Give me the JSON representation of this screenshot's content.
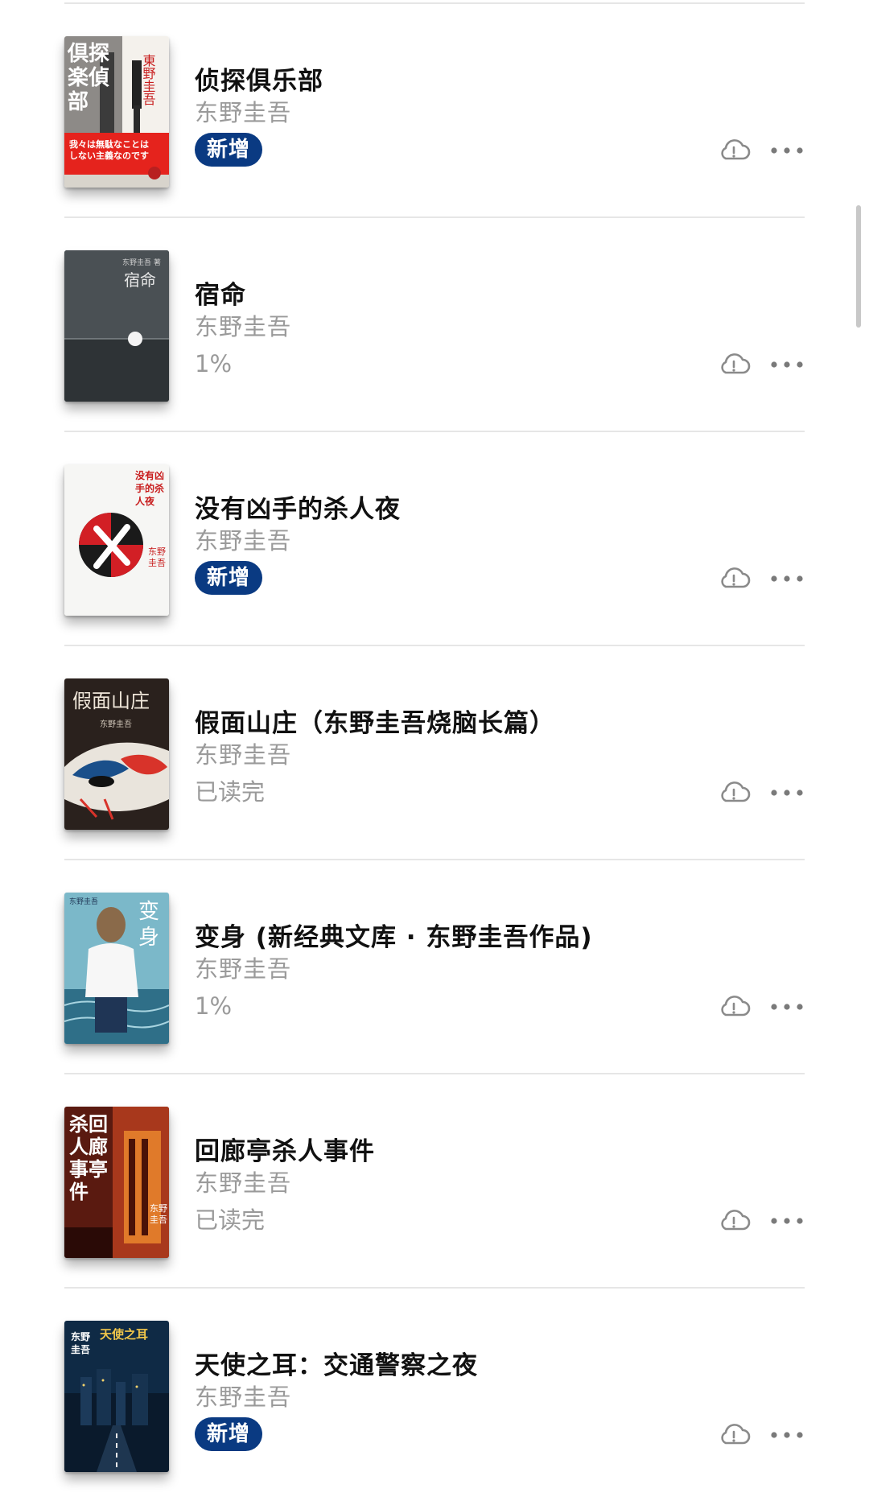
{
  "books": [
    {
      "title": "侦探俱乐部",
      "author": "东野圭吾",
      "status_type": "badge",
      "status": "新增",
      "cover_text": "探偵倶楽部",
      "cover_author": "東野圭吾"
    },
    {
      "title": "宿命",
      "author": "东野圭吾",
      "status_type": "progress",
      "status": "1%",
      "cover_text": "宿命",
      "cover_author": "东野圭吾 著"
    },
    {
      "title": "没有凶手的杀人夜",
      "author": "东野圭吾",
      "status_type": "badge",
      "status": "新增",
      "cover_text": "没有凶手的杀人夜",
      "cover_author": "东野圭吾"
    },
    {
      "title": "假面山庄（东野圭吾烧脑长篇）",
      "author": "东野圭吾",
      "status_type": "progress",
      "status": "已读完",
      "cover_text": "假面山庄",
      "cover_author": "东野圭吾"
    },
    {
      "title": "变身 (新经典文库 · 东野圭吾作品)",
      "author": "东野圭吾",
      "status_type": "progress",
      "status": "1%",
      "cover_text": "变身",
      "cover_author": "东野圭吾"
    },
    {
      "title": "回廊亭杀人事件",
      "author": "东野圭吾",
      "status_type": "progress",
      "status": "已读完",
      "cover_text": "回廊亭杀人事件",
      "cover_author": "东野圭吾"
    },
    {
      "title": "天使之耳：交通警察之夜",
      "author": "东野圭吾",
      "status_type": "badge",
      "status": "新增",
      "cover_text": "天使之耳",
      "cover_author": "东野圭吾"
    }
  ],
  "icons": {
    "download": "cloud-alert-icon",
    "more": "more-horizontal-icon"
  },
  "colors": {
    "badge_bg": "#0a3a82",
    "badge_text": "#ffffff",
    "secondary_text": "#9a9a9a",
    "divider": "#e6e6e6",
    "icon": "#8a8a8a"
  }
}
